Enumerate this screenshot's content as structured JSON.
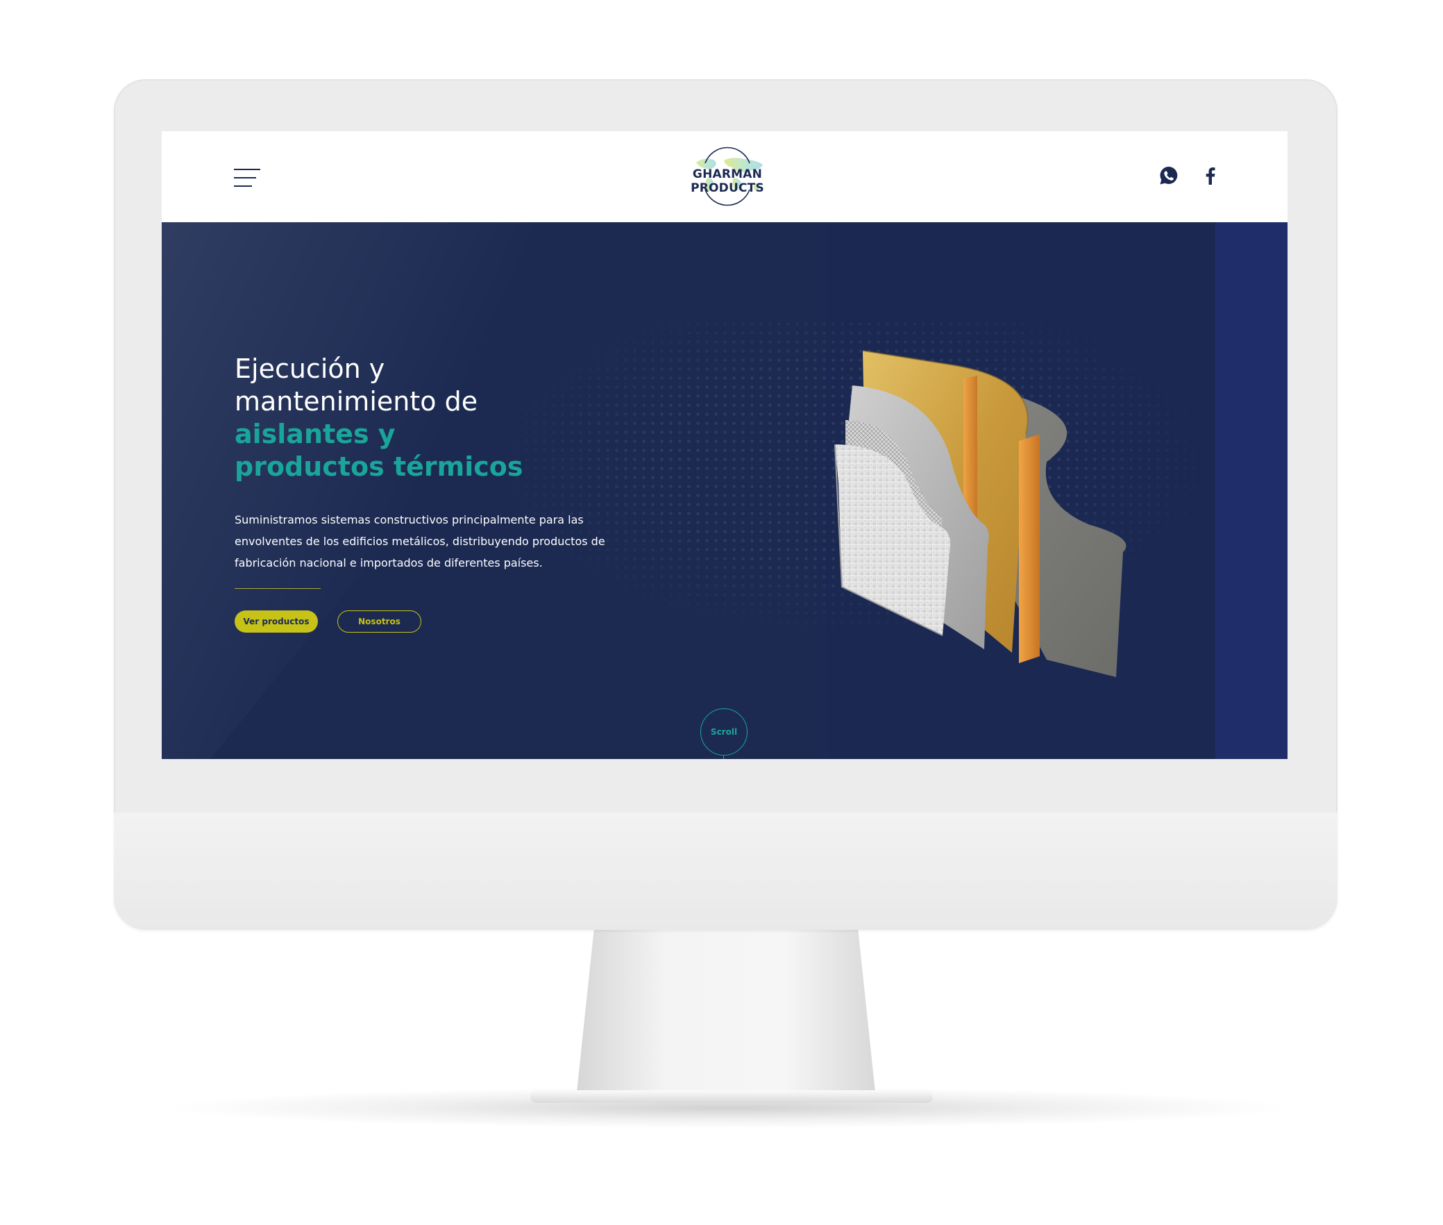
{
  "site": {
    "logo_text": "GHARMAN PRODUCTS"
  },
  "header": {
    "menu_icon": "hamburger-icon",
    "social": [
      {
        "icon": "whatsapp-icon"
      },
      {
        "icon": "facebook-icon"
      }
    ]
  },
  "hero": {
    "headline_line1": "Ejecución y",
    "headline_line2": "mantenimiento de",
    "headline_accent1": "aislantes y",
    "headline_accent2": "productos térmicos",
    "description_line1": "Suministramos sistemas constructivos principalmente para las",
    "description_line2": "envolventes de los edificios metálicos, distribuyendo productos de",
    "description_line3": "fabricación nacional e importados de diferentes países.",
    "primary_button": "Ver productos",
    "secondary_button": "Nosotros",
    "scroll_label": "Scroll"
  },
  "colors": {
    "navy": "#1c2a52",
    "teal": "#1aa59a",
    "lime": "#c6c218",
    "white": "#ffffff"
  }
}
